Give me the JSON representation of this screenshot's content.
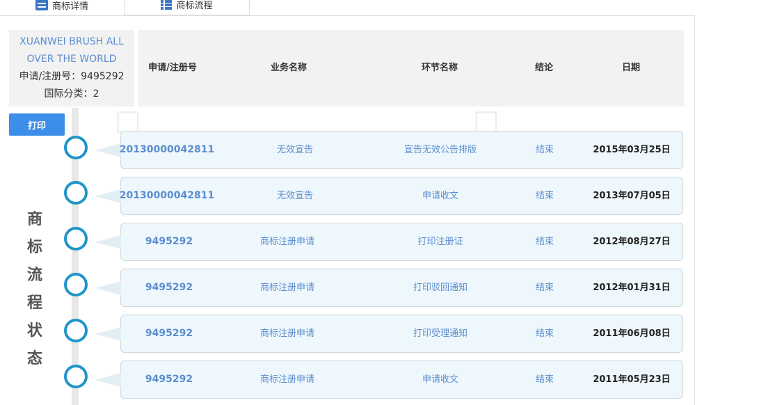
{
  "tabs": [
    {
      "label": "商标详情",
      "icon": "document-icon"
    },
    {
      "label": "商标流程",
      "icon": "list-icon"
    }
  ],
  "info": {
    "name": "XUANWEI BRUSH ALL OVER THE WORLD",
    "reg_no_text": "申请/注册号：9495292",
    "class_text": "国际分类：2"
  },
  "print_label": "打印",
  "side_title": [
    "商",
    "标",
    "流",
    "程",
    "状",
    "态"
  ],
  "columns": [
    "申请/注册号",
    "业务名称",
    "环节名称",
    "结论",
    "日期"
  ],
  "rows": [
    {
      "no": "20130000042811",
      "biz": "无效宣告",
      "step": "宣告无效公告排版",
      "result": "结束",
      "date": "2015年03月25日"
    },
    {
      "no": "20130000042811",
      "biz": "无效宣告",
      "step": "申请收文",
      "result": "结束",
      "date": "2013年07月05日"
    },
    {
      "no": "9495292",
      "biz": "商标注册申请",
      "step": "打印注册证",
      "result": "结束",
      "date": "2012年08月27日"
    },
    {
      "no": "9495292",
      "biz": "商标注册申请",
      "step": "打印驳回通知",
      "result": "结束",
      "date": "2012年01月31日"
    },
    {
      "no": "9495292",
      "biz": "商标注册申请",
      "step": "打印受理通知",
      "result": "结束",
      "date": "2011年06月08日"
    },
    {
      "no": "9495292",
      "biz": "商标注册申请",
      "step": "申请收文",
      "result": "结束",
      "date": "2011年05月23日"
    }
  ],
  "colors": {
    "accent": "#3d8ee8",
    "timeline": "#1f95c9",
    "link": "#5b8dd0"
  }
}
